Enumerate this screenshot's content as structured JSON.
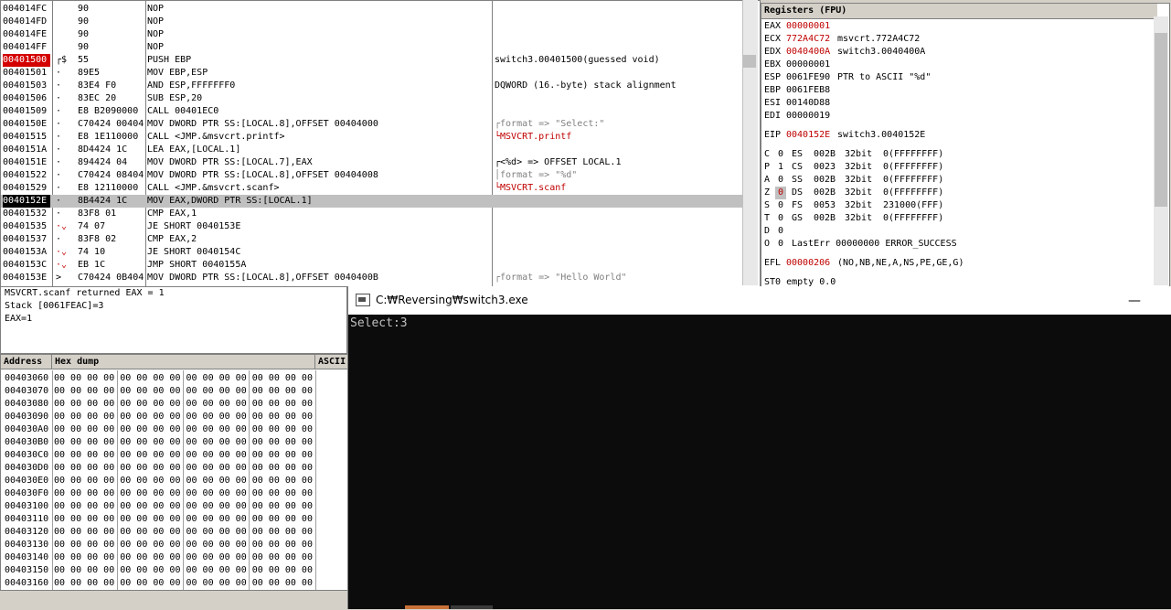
{
  "disasm": {
    "rows": [
      {
        "addr": "004014FC",
        "mark": "",
        "hex": "90",
        "cmd": "NOP",
        "comment": "",
        "cmt_type": "",
        "state": ""
      },
      {
        "addr": "004014FD",
        "mark": "",
        "hex": "90",
        "cmd": "NOP",
        "comment": "",
        "cmt_type": "",
        "state": ""
      },
      {
        "addr": "004014FE",
        "mark": "",
        "hex": "90",
        "cmd": "NOP",
        "comment": "",
        "cmt_type": "",
        "state": ""
      },
      {
        "addr": "004014FF",
        "mark": "",
        "hex": "90",
        "cmd": "NOP",
        "comment": "",
        "cmt_type": "",
        "state": ""
      },
      {
        "addr": "00401500",
        "mark": "┌$",
        "hex": "55",
        "cmd": "PUSH EBP",
        "comment": "switch3.00401500(guessed void)",
        "cmt_type": "plain",
        "state": "bp"
      },
      {
        "addr": "00401501",
        "mark": "·",
        "hex": "89E5",
        "cmd": "MOV EBP,ESP",
        "comment": "",
        "cmt_type": "",
        "state": ""
      },
      {
        "addr": "00401503",
        "mark": "·",
        "hex": "83E4 F0",
        "cmd": "AND ESP,FFFFFFF0",
        "comment": "DQWORD (16.-byte) stack alignment",
        "cmt_type": "plain",
        "state": ""
      },
      {
        "addr": "00401506",
        "mark": "·",
        "hex": "83EC 20",
        "cmd": "SUB ESP,20",
        "comment": "",
        "cmt_type": "",
        "state": ""
      },
      {
        "addr": "00401509",
        "mark": "·",
        "hex": "E8 B2090000",
        "cmd": "CALL 00401EC0",
        "comment": "",
        "cmt_type": "",
        "state": ""
      },
      {
        "addr": "0040150E",
        "mark": "·",
        "hex": "C70424 00404",
        "cmd": "MOV DWORD PTR SS:[LOCAL.8],OFFSET 00404000",
        "comment": "┌format => \"Select:\"",
        "cmt_type": "dim",
        "state": ""
      },
      {
        "addr": "00401515",
        "mark": "·",
        "hex": "E8 1E110000",
        "cmd": "CALL <JMP.&msvcrt.printf>",
        "comment": "└MSVCRT.printf",
        "cmt_type": "red",
        "state": ""
      },
      {
        "addr": "0040151A",
        "mark": "·",
        "hex": "8D4424 1C",
        "cmd": "LEA EAX,[LOCAL.1]",
        "comment": "",
        "cmt_type": "",
        "state": ""
      },
      {
        "addr": "0040151E",
        "mark": "·",
        "hex": "894424 04",
        "cmd": "MOV DWORD PTR SS:[LOCAL.7],EAX",
        "comment": "┌<%d> => OFFSET LOCAL.1",
        "cmt_type": "plain",
        "state": ""
      },
      {
        "addr": "00401522",
        "mark": "·",
        "hex": "C70424 08404",
        "cmd": "MOV DWORD PTR SS:[LOCAL.8],OFFSET 00404008",
        "comment": "│format => \"%d\"",
        "cmt_type": "dim",
        "state": ""
      },
      {
        "addr": "00401529",
        "mark": "·",
        "hex": "E8 12110000",
        "cmd": "CALL <JMP.&msvcrt.scanf>",
        "comment": "└MSVCRT.scanf",
        "cmt_type": "red",
        "state": ""
      },
      {
        "addr": "0040152E",
        "mark": "·",
        "hex": "8B4424 1C",
        "cmd": "MOV EAX,DWORD PTR SS:[LOCAL.1]",
        "comment": "",
        "cmt_type": "",
        "state": "eip"
      },
      {
        "addr": "00401532",
        "mark": "·",
        "hex": "83F8 01",
        "cmd": "CMP EAX,1",
        "comment": "",
        "cmt_type": "",
        "state": ""
      },
      {
        "addr": "00401535",
        "mark": "·⌄",
        "hex": "74 07",
        "cmd": "JE SHORT 0040153E",
        "comment": "",
        "cmt_type": "",
        "state": ""
      },
      {
        "addr": "00401537",
        "mark": "·",
        "hex": "83F8 02",
        "cmd": "CMP EAX,2",
        "comment": "",
        "cmt_type": "",
        "state": ""
      },
      {
        "addr": "0040153A",
        "mark": "·⌄",
        "hex": "74 10",
        "cmd": "JE SHORT 0040154C",
        "comment": "",
        "cmt_type": "",
        "state": ""
      },
      {
        "addr": "0040153C",
        "mark": "·⌄",
        "hex": "EB 1C",
        "cmd": "JMP SHORT 0040155A",
        "comment": "",
        "cmt_type": "",
        "state": ""
      },
      {
        "addr": "0040153E",
        "mark": ">",
        "hex": "C70424 0B404",
        "cmd": "MOV DWORD PTR SS:[LOCAL.8],OFFSET 0040400B",
        "comment": "┌format => \"Hello World\"",
        "cmt_type": "dim",
        "state": ""
      }
    ]
  },
  "registers": {
    "title": "Registers (FPU)",
    "gp": [
      {
        "name": "EAX",
        "value": "00000001",
        "changed": true,
        "desc": ""
      },
      {
        "name": "ECX",
        "value": "772A4C72",
        "changed": true,
        "desc": "msvcrt.772A4C72"
      },
      {
        "name": "EDX",
        "value": "0040400A",
        "changed": true,
        "desc": "switch3.0040400A"
      },
      {
        "name": "EBX",
        "value": "00000001",
        "changed": false,
        "desc": ""
      },
      {
        "name": "ESP",
        "value": "0061FE90",
        "changed": false,
        "desc": "PTR to ASCII \"%d\""
      },
      {
        "name": "EBP",
        "value": "0061FEB8",
        "changed": false,
        "desc": ""
      },
      {
        "name": "ESI",
        "value": "00140D88",
        "changed": false,
        "desc": ""
      },
      {
        "name": "EDI",
        "value": "00000019",
        "changed": false,
        "desc": ""
      }
    ],
    "eip": {
      "name": "EIP",
      "value": "0040152E",
      "desc": "switch3.0040152E"
    },
    "flags": [
      {
        "f": "C",
        "v": "0",
        "seg": "ES",
        "sel": "002B",
        "bits": "32bit",
        "desc": "0(FFFFFFFF)",
        "hl": false
      },
      {
        "f": "P",
        "v": "1",
        "seg": "CS",
        "sel": "0023",
        "bits": "32bit",
        "desc": "0(FFFFFFFF)",
        "hl": false
      },
      {
        "f": "A",
        "v": "0",
        "seg": "SS",
        "sel": "002B",
        "bits": "32bit",
        "desc": "0(FFFFFFFF)",
        "hl": false
      },
      {
        "f": "Z",
        "v": "0",
        "seg": "DS",
        "sel": "002B",
        "bits": "32bit",
        "desc": "0(FFFFFFFF)",
        "hl": true
      },
      {
        "f": "S",
        "v": "0",
        "seg": "FS",
        "sel": "0053",
        "bits": "32bit",
        "desc": "231000(FFF)",
        "hl": false
      },
      {
        "f": "T",
        "v": "0",
        "seg": "GS",
        "sel": "002B",
        "bits": "32bit",
        "desc": "0(FFFFFFFF)",
        "hl": false
      },
      {
        "f": "D",
        "v": "0",
        "seg": "",
        "sel": "",
        "bits": "",
        "desc": "",
        "hl": false
      },
      {
        "f": "O",
        "v": "0",
        "seg": "",
        "sel": "",
        "bits": "",
        "desc": "LastErr 00000000 ERROR_SUCCESS",
        "hl": false
      }
    ],
    "efl": {
      "name": "EFL",
      "value": "00000206",
      "desc": "(NO,NB,NE,A,NS,PE,GE,G)"
    },
    "st0": "ST0 empty 0.0"
  },
  "info": {
    "lines": [
      "MSVCRT.scanf returned EAX = 1",
      "Stack [0061FEAC]=3",
      "EAX=1"
    ]
  },
  "dump": {
    "headers": {
      "address": "Address",
      "hex": "Hex dump",
      "ascii": "ASCII"
    },
    "rows": [
      {
        "addr": "00403060",
        "hex": "00 00 00 00 00 00 00 00 00 00 00 00 00 00 00 00"
      },
      {
        "addr": "00403070",
        "hex": "00 00 00 00 00 00 00 00 00 00 00 00 00 00 00 00"
      },
      {
        "addr": "00403080",
        "hex": "00 00 00 00 00 00 00 00 00 00 00 00 00 00 00 00"
      },
      {
        "addr": "00403090",
        "hex": "00 00 00 00 00 00 00 00 00 00 00 00 00 00 00 00"
      },
      {
        "addr": "004030A0",
        "hex": "00 00 00 00 00 00 00 00 00 00 00 00 00 00 00 00"
      },
      {
        "addr": "004030B0",
        "hex": "00 00 00 00 00 00 00 00 00 00 00 00 00 00 00 00"
      },
      {
        "addr": "004030C0",
        "hex": "00 00 00 00 00 00 00 00 00 00 00 00 00 00 00 00"
      },
      {
        "addr": "004030D0",
        "hex": "00 00 00 00 00 00 00 00 00 00 00 00 00 00 00 00"
      },
      {
        "addr": "004030E0",
        "hex": "00 00 00 00 00 00 00 00 00 00 00 00 00 00 00 00"
      },
      {
        "addr": "004030F0",
        "hex": "00 00 00 00 00 00 00 00 00 00 00 00 00 00 00 00"
      },
      {
        "addr": "00403100",
        "hex": "00 00 00 00 00 00 00 00 00 00 00 00 00 00 00 00"
      },
      {
        "addr": "00403110",
        "hex": "00 00 00 00 00 00 00 00 00 00 00 00 00 00 00 00"
      },
      {
        "addr": "00403120",
        "hex": "00 00 00 00 00 00 00 00 00 00 00 00 00 00 00 00"
      },
      {
        "addr": "00403130",
        "hex": "00 00 00 00 00 00 00 00 00 00 00 00 00 00 00 00"
      },
      {
        "addr": "00403140",
        "hex": "00 00 00 00 00 00 00 00 00 00 00 00 00 00 00 00"
      },
      {
        "addr": "00403150",
        "hex": "00 00 00 00 00 00 00 00 00 00 00 00 00 00 00 00"
      },
      {
        "addr": "00403160",
        "hex": "00 00 00 00 00 00 00 00 00 00 00 00 00 00 00 00"
      }
    ]
  },
  "console": {
    "title": "C:₩Reversing₩switch3.exe",
    "minimize_glyph": "—",
    "output": "Select:3"
  },
  "colors": {
    "breakpoint": "#d40000",
    "changed_register": "#c00000",
    "console_bg": "#0c0c0c",
    "console_text": "#c0c0c0"
  }
}
